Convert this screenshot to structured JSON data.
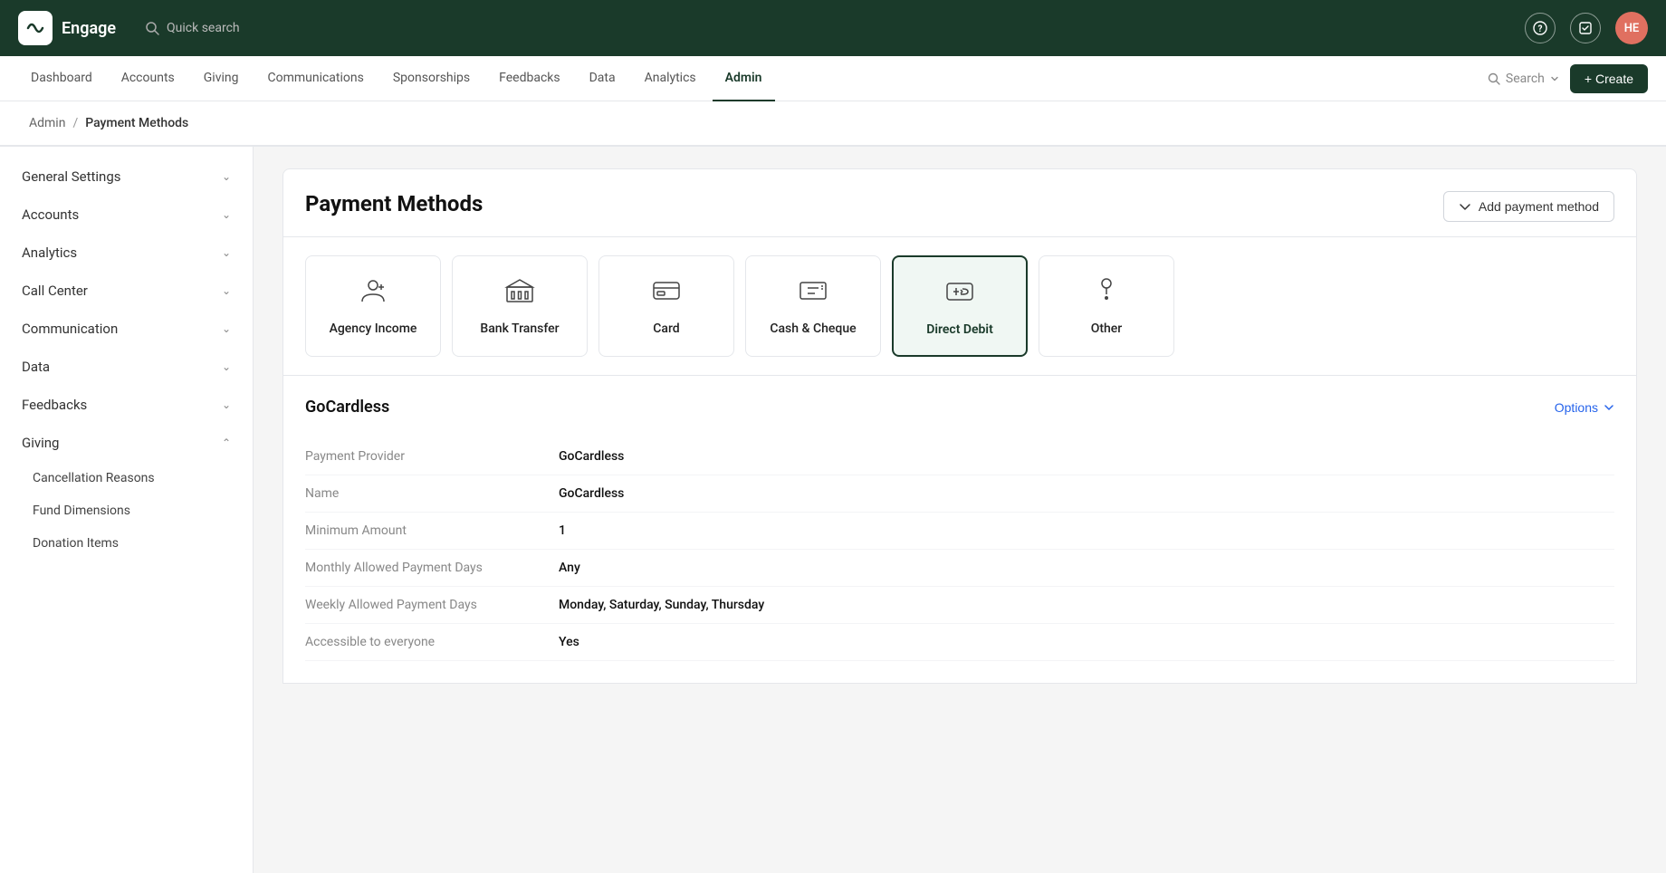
{
  "app": {
    "name": "Engage",
    "avatar_initials": "HE"
  },
  "top_nav": {
    "search_placeholder": "Quick search",
    "items": [
      {
        "label": "Dashboard",
        "active": false
      },
      {
        "label": "Accounts",
        "active": false
      },
      {
        "label": "Giving",
        "active": false
      },
      {
        "label": "Communications",
        "active": false
      },
      {
        "label": "Sponsorships",
        "active": false
      },
      {
        "label": "Feedbacks",
        "active": false
      },
      {
        "label": "Data",
        "active": false
      },
      {
        "label": "Analytics",
        "active": false
      },
      {
        "label": "Admin",
        "active": true
      }
    ],
    "search_label": "Search",
    "create_label": "+ Create"
  },
  "breadcrumb": {
    "parent": "Admin",
    "separator": "/",
    "current": "Payment Methods"
  },
  "sidebar": {
    "sections": [
      {
        "label": "General Settings",
        "expanded": false,
        "children": []
      },
      {
        "label": "Accounts",
        "expanded": false,
        "children": []
      },
      {
        "label": "Analytics",
        "expanded": false,
        "children": []
      },
      {
        "label": "Call Center",
        "expanded": false,
        "children": []
      },
      {
        "label": "Communication",
        "expanded": false,
        "children": []
      },
      {
        "label": "Data",
        "expanded": false,
        "children": []
      },
      {
        "label": "Feedbacks",
        "expanded": false,
        "children": []
      },
      {
        "label": "Giving",
        "expanded": true,
        "children": [
          {
            "label": "Cancellation Reasons"
          },
          {
            "label": "Fund Dimensions"
          },
          {
            "label": "Donation Items"
          }
        ]
      }
    ]
  },
  "page": {
    "title": "Payment Methods",
    "add_button_label": "Add payment method"
  },
  "payment_methods": [
    {
      "id": "agency",
      "label": "Agency Income",
      "icon": "agency"
    },
    {
      "id": "bank",
      "label": "Bank Transfer",
      "icon": "bank"
    },
    {
      "id": "card",
      "label": "Card",
      "icon": "card"
    },
    {
      "id": "cash",
      "label": "Cash & Cheque",
      "icon": "cash"
    },
    {
      "id": "direct_debit",
      "label": "Direct Debit",
      "icon": "direct_debit",
      "active": true
    },
    {
      "id": "other",
      "label": "Other",
      "icon": "other"
    }
  ],
  "detail": {
    "title": "GoCardless",
    "options_label": "Options",
    "fields": [
      {
        "label": "Payment Provider",
        "value": "GoCardless"
      },
      {
        "label": "Name",
        "value": "GoCardless"
      },
      {
        "label": "Minimum Amount",
        "value": "1"
      },
      {
        "label": "Monthly Allowed Payment Days",
        "value": "Any"
      },
      {
        "label": "Weekly Allowed Payment Days",
        "value": "Monday, Saturday, Sunday, Thursday"
      },
      {
        "label": "Accessible to everyone",
        "value": "Yes"
      }
    ]
  }
}
